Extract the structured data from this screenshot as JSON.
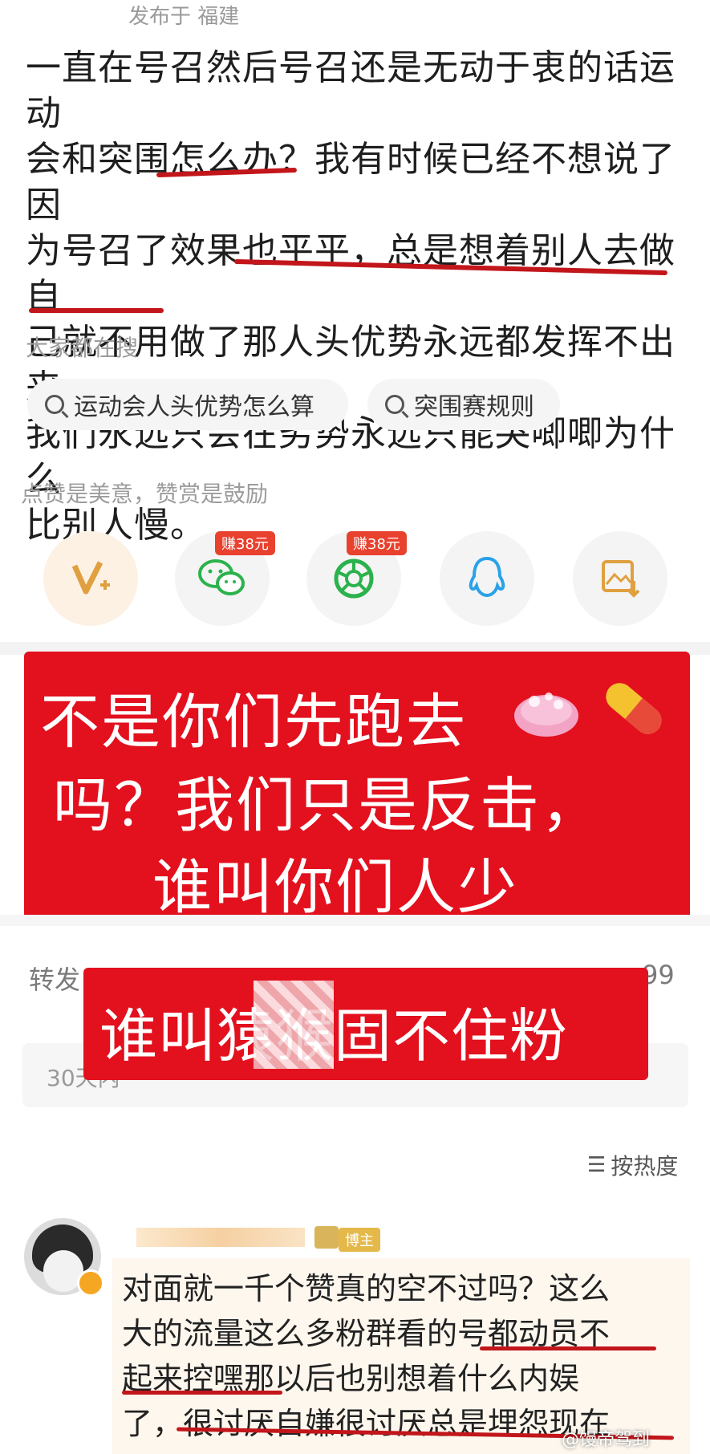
{
  "post": {
    "location": "发布于 福建",
    "lines": [
      "一直在号召然后号召还是无动于衷的话运动",
      "会和突围怎么办？我有时候已经不想说了因",
      "为号召了效果也平平，总是想着别人去做自",
      "己就不用做了那人头优势永远都发挥不出来",
      "我们永远只会在劣势永远只能哭唧唧为什么",
      "比别人慢。"
    ]
  },
  "search": {
    "title": "大家都在搜",
    "chips": [
      "运动会人头优势怎么算",
      "突围赛规则"
    ]
  },
  "reward": {
    "caption": "点赞是美意，赞赏是鼓励",
    "badge1": "赚38元",
    "badge2": "赚38元",
    "icons": [
      "v-plus-icon",
      "wechat-icon",
      "moments-icon",
      "qq-icon",
      "save-image-icon"
    ]
  },
  "overlay1": {
    "line1": "不是你们先跑去",
    "line2": "吗？我们只是反击，",
    "line3": "谁叫你们人少"
  },
  "overlay2": {
    "text": "谁叫猿猴固不住粉"
  },
  "stats": {
    "repost": "转发",
    "right_number": "99"
  },
  "notice": "30天内",
  "sort_label": "按热度",
  "comment": {
    "user_tag": "博主",
    "lines": [
      "对面就一千个赞真的空不过吗？这么",
      "大的流量这么多粉群看的号都动员不",
      "起来控嘿那以后也别想着什么内娱",
      "了，很讨厌自嫌很讨厌总是埋怨现在"
    ]
  },
  "watermark": "@馒帝驾到",
  "colors": {
    "accent_red": "#e3101e",
    "underline_red": "#c2161b"
  }
}
